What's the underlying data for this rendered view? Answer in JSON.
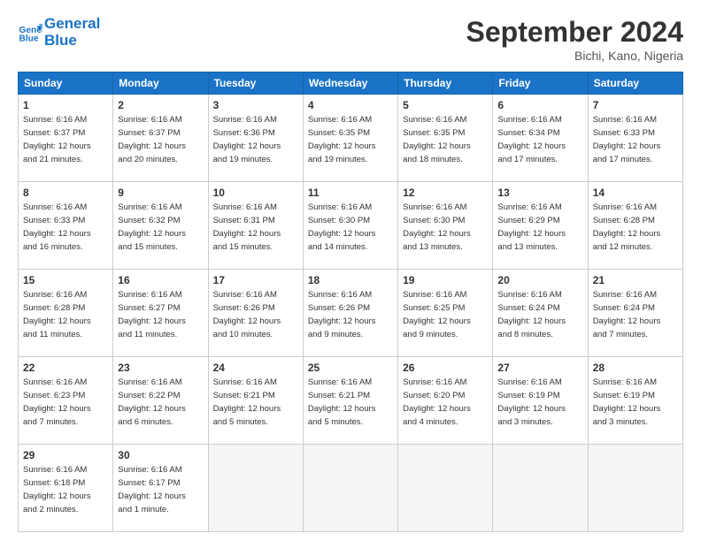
{
  "header": {
    "logo_line1": "General",
    "logo_line2": "Blue",
    "month": "September 2024",
    "location": "Bichi, Kano, Nigeria"
  },
  "weekdays": [
    "Sunday",
    "Monday",
    "Tuesday",
    "Wednesday",
    "Thursday",
    "Friday",
    "Saturday"
  ],
  "weeks": [
    [
      {
        "day": "1",
        "info": "Sunrise: 6:16 AM\nSunset: 6:37 PM\nDaylight: 12 hours\nand 21 minutes."
      },
      {
        "day": "2",
        "info": "Sunrise: 6:16 AM\nSunset: 6:37 PM\nDaylight: 12 hours\nand 20 minutes."
      },
      {
        "day": "3",
        "info": "Sunrise: 6:16 AM\nSunset: 6:36 PM\nDaylight: 12 hours\nand 19 minutes."
      },
      {
        "day": "4",
        "info": "Sunrise: 6:16 AM\nSunset: 6:35 PM\nDaylight: 12 hours\nand 19 minutes."
      },
      {
        "day": "5",
        "info": "Sunrise: 6:16 AM\nSunset: 6:35 PM\nDaylight: 12 hours\nand 18 minutes."
      },
      {
        "day": "6",
        "info": "Sunrise: 6:16 AM\nSunset: 6:34 PM\nDaylight: 12 hours\nand 17 minutes."
      },
      {
        "day": "7",
        "info": "Sunrise: 6:16 AM\nSunset: 6:33 PM\nDaylight: 12 hours\nand 17 minutes."
      }
    ],
    [
      {
        "day": "8",
        "info": "Sunrise: 6:16 AM\nSunset: 6:33 PM\nDaylight: 12 hours\nand 16 minutes."
      },
      {
        "day": "9",
        "info": "Sunrise: 6:16 AM\nSunset: 6:32 PM\nDaylight: 12 hours\nand 15 minutes."
      },
      {
        "day": "10",
        "info": "Sunrise: 6:16 AM\nSunset: 6:31 PM\nDaylight: 12 hours\nand 15 minutes."
      },
      {
        "day": "11",
        "info": "Sunrise: 6:16 AM\nSunset: 6:30 PM\nDaylight: 12 hours\nand 14 minutes."
      },
      {
        "day": "12",
        "info": "Sunrise: 6:16 AM\nSunset: 6:30 PM\nDaylight: 12 hours\nand 13 minutes."
      },
      {
        "day": "13",
        "info": "Sunrise: 6:16 AM\nSunset: 6:29 PM\nDaylight: 12 hours\nand 13 minutes."
      },
      {
        "day": "14",
        "info": "Sunrise: 6:16 AM\nSunset: 6:28 PM\nDaylight: 12 hours\nand 12 minutes."
      }
    ],
    [
      {
        "day": "15",
        "info": "Sunrise: 6:16 AM\nSunset: 6:28 PM\nDaylight: 12 hours\nand 11 minutes."
      },
      {
        "day": "16",
        "info": "Sunrise: 6:16 AM\nSunset: 6:27 PM\nDaylight: 12 hours\nand 11 minutes."
      },
      {
        "day": "17",
        "info": "Sunrise: 6:16 AM\nSunset: 6:26 PM\nDaylight: 12 hours\nand 10 minutes."
      },
      {
        "day": "18",
        "info": "Sunrise: 6:16 AM\nSunset: 6:26 PM\nDaylight: 12 hours\nand 9 minutes."
      },
      {
        "day": "19",
        "info": "Sunrise: 6:16 AM\nSunset: 6:25 PM\nDaylight: 12 hours\nand 9 minutes."
      },
      {
        "day": "20",
        "info": "Sunrise: 6:16 AM\nSunset: 6:24 PM\nDaylight: 12 hours\nand 8 minutes."
      },
      {
        "day": "21",
        "info": "Sunrise: 6:16 AM\nSunset: 6:24 PM\nDaylight: 12 hours\nand 7 minutes."
      }
    ],
    [
      {
        "day": "22",
        "info": "Sunrise: 6:16 AM\nSunset: 6:23 PM\nDaylight: 12 hours\nand 7 minutes."
      },
      {
        "day": "23",
        "info": "Sunrise: 6:16 AM\nSunset: 6:22 PM\nDaylight: 12 hours\nand 6 minutes."
      },
      {
        "day": "24",
        "info": "Sunrise: 6:16 AM\nSunset: 6:21 PM\nDaylight: 12 hours\nand 5 minutes."
      },
      {
        "day": "25",
        "info": "Sunrise: 6:16 AM\nSunset: 6:21 PM\nDaylight: 12 hours\nand 5 minutes."
      },
      {
        "day": "26",
        "info": "Sunrise: 6:16 AM\nSunset: 6:20 PM\nDaylight: 12 hours\nand 4 minutes."
      },
      {
        "day": "27",
        "info": "Sunrise: 6:16 AM\nSunset: 6:19 PM\nDaylight: 12 hours\nand 3 minutes."
      },
      {
        "day": "28",
        "info": "Sunrise: 6:16 AM\nSunset: 6:19 PM\nDaylight: 12 hours\nand 3 minutes."
      }
    ],
    [
      {
        "day": "29",
        "info": "Sunrise: 6:16 AM\nSunset: 6:18 PM\nDaylight: 12 hours\nand 2 minutes."
      },
      {
        "day": "30",
        "info": "Sunrise: 6:16 AM\nSunset: 6:17 PM\nDaylight: 12 hours\nand 1 minute."
      },
      {
        "day": "",
        "info": ""
      },
      {
        "day": "",
        "info": ""
      },
      {
        "day": "",
        "info": ""
      },
      {
        "day": "",
        "info": ""
      },
      {
        "day": "",
        "info": ""
      }
    ]
  ]
}
